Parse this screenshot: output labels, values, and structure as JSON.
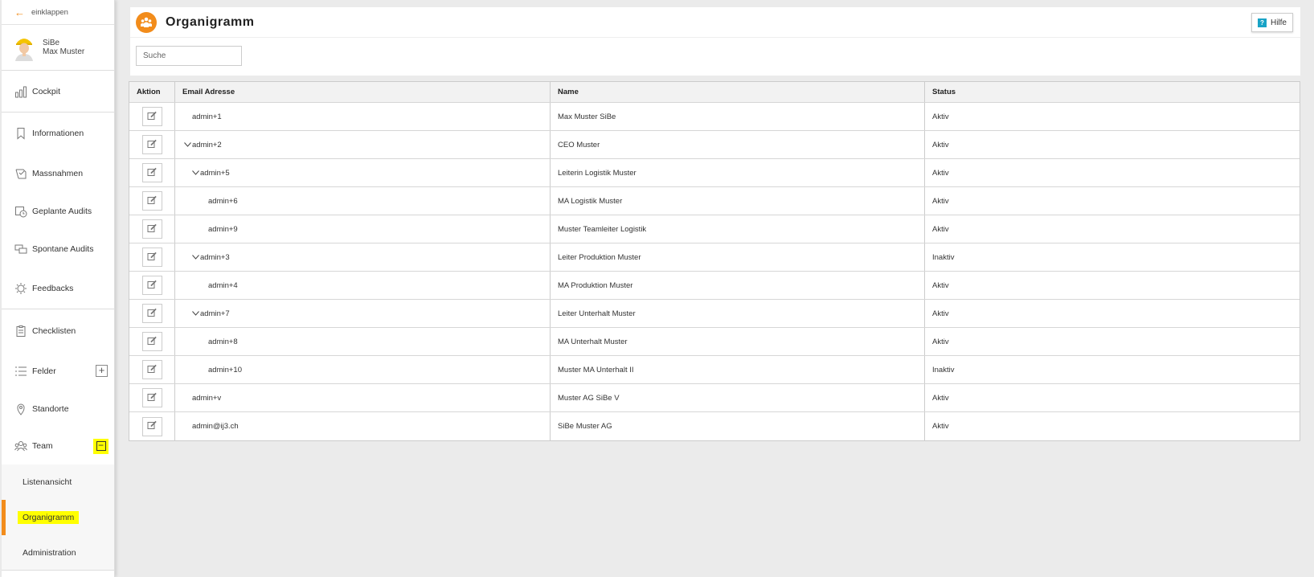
{
  "sidebar": {
    "collapse_label": "einklappen",
    "user": {
      "role": "SiBe",
      "name": "Max Muster"
    },
    "items": [
      {
        "label": "Cockpit",
        "icon": "chart-icon"
      },
      {
        "label": "Informationen",
        "icon": "bookmark-icon"
      },
      {
        "label": "Massnahmen",
        "icon": "checklist-icon"
      },
      {
        "label": "Geplante Audits",
        "icon": "calendar-clock-icon"
      },
      {
        "label": "Spontane Audits",
        "icon": "chat-icon"
      },
      {
        "label": "Feedbacks",
        "icon": "feedback-icon"
      },
      {
        "label": "Checklisten",
        "icon": "clipboard-icon"
      },
      {
        "label": "Felder",
        "icon": "list-icon",
        "expand": "+"
      },
      {
        "label": "Standorte",
        "icon": "location-icon"
      },
      {
        "label": "Team",
        "icon": "team-icon",
        "expand": "−"
      }
    ],
    "team_sub": [
      {
        "label": "Listenansicht"
      },
      {
        "label": "Organigramm"
      },
      {
        "label": "Administration"
      }
    ]
  },
  "header": {
    "title": "Organigramm",
    "help_label": "Hilfe",
    "search_placeholder": "Suche"
  },
  "table": {
    "columns": [
      "Aktion",
      "Email Adresse",
      "Name",
      "Status"
    ],
    "rows": [
      {
        "email": "admin+1",
        "level": 1,
        "expandable": false,
        "name": "Max Muster SiBe",
        "status": "Aktiv"
      },
      {
        "email": "admin+2",
        "level": 1,
        "expandable": true,
        "name": "CEO Muster",
        "status": "Aktiv"
      },
      {
        "email": "admin+5",
        "level": 2,
        "expandable": true,
        "name": "Leiterin Logistik Muster",
        "status": "Aktiv"
      },
      {
        "email": "admin+6",
        "level": 3,
        "expandable": false,
        "name": "MA Logistik Muster",
        "status": "Aktiv"
      },
      {
        "email": "admin+9",
        "level": 3,
        "expandable": false,
        "name": "Muster Teamleiter Logistik",
        "status": "Aktiv"
      },
      {
        "email": "admin+3",
        "level": 2,
        "expandable": true,
        "name": "Leiter Produktion Muster",
        "status": "Inaktiv"
      },
      {
        "email": "admin+4",
        "level": 3,
        "expandable": false,
        "name": "MA Produktion Muster",
        "status": "Aktiv"
      },
      {
        "email": "admin+7",
        "level": 2,
        "expandable": true,
        "name": "Leiter Unterhalt Muster",
        "status": "Aktiv"
      },
      {
        "email": "admin+8",
        "level": 3,
        "expandable": false,
        "name": "MA Unterhalt Muster",
        "status": "Aktiv"
      },
      {
        "email": "admin+10",
        "level": 3,
        "expandable": false,
        "name": "Muster MA Unterhalt II",
        "status": "Inaktiv"
      },
      {
        "email": "admin+v",
        "level": 1,
        "expandable": false,
        "name": "Muster AG SiBe V",
        "status": "Aktiv"
      },
      {
        "email": "admin@ij3.ch",
        "level": 1,
        "expandable": false,
        "name": "SiBe Muster AG",
        "status": "Aktiv"
      }
    ]
  },
  "colors": {
    "accent": "#f28c1b",
    "highlight": "#ffff00",
    "help_icon": "#19a3c6"
  }
}
